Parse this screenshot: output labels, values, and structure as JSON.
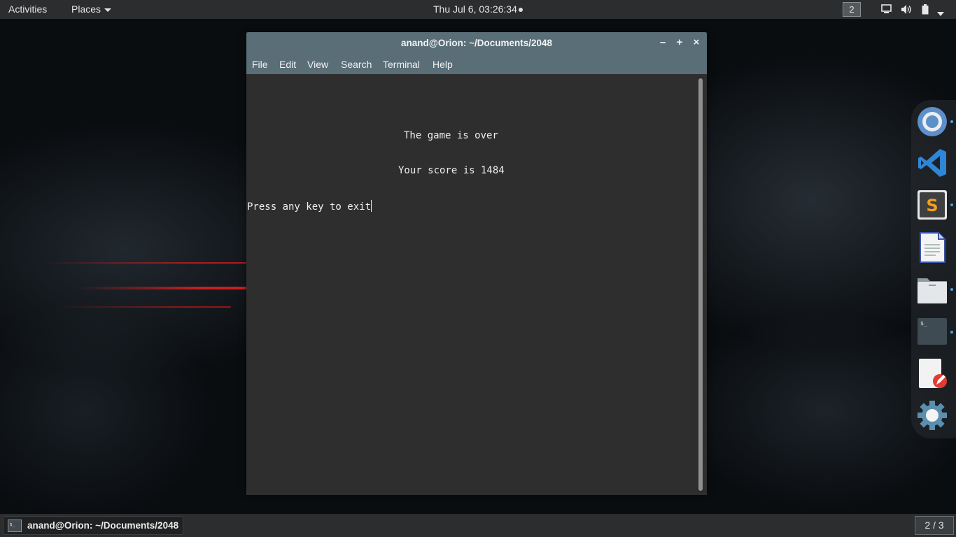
{
  "topbar": {
    "activities": "Activities",
    "places": "Places",
    "clock": "Thu Jul  6, 03:26:34",
    "workspace": "2",
    "icons": [
      "display-icon",
      "volume-icon",
      "battery-icon",
      "power-menu-caret-icon"
    ]
  },
  "window": {
    "title": "anand@Orion: ~/Documents/2048",
    "menu": [
      "File",
      "Edit",
      "View",
      "Search",
      "Terminal",
      "Help"
    ],
    "controls": {
      "minimize": "–",
      "maximize": "+",
      "close": "×"
    }
  },
  "terminal": {
    "line1": "The game is over",
    "line2": "Your score is 1484",
    "line3": "Press any key to exit"
  },
  "dock": {
    "items": [
      "chromium-icon",
      "vscode-icon",
      "sublime-text-icon",
      "libreoffice-writer-icon",
      "files-icon",
      "terminal-icon",
      "text-editor-icon",
      "settings-icon"
    ]
  },
  "bottombar": {
    "task_label": "anand@Orion: ~/Documents/2048",
    "workspace_indicator": "2 / 3"
  },
  "colors": {
    "titlebar": "#596e77",
    "terminal_bg": "#2e2e2e",
    "panel": "#2b2d2e",
    "accent_dot": "#4aa3df"
  }
}
